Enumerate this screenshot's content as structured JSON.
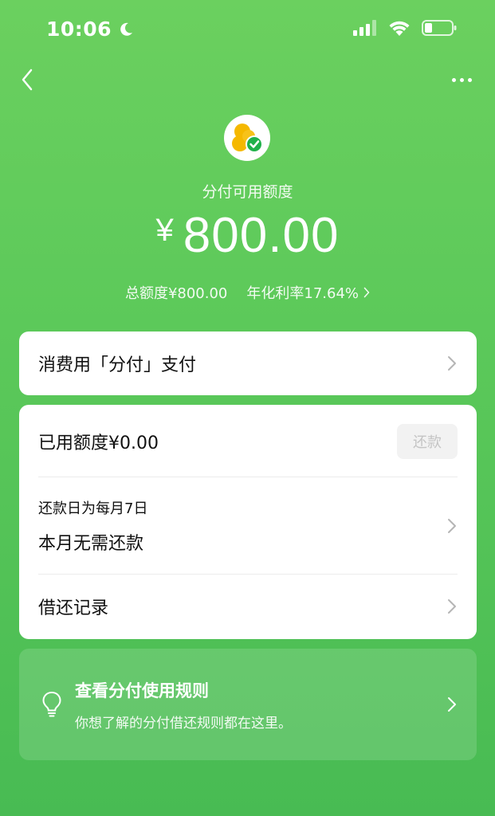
{
  "status_bar": {
    "time": "10:06",
    "icons": [
      "moon-icon",
      "signal-icon",
      "wifi-icon",
      "battery-icon"
    ]
  },
  "nav": {
    "back_icon": "back-chevron-icon",
    "more_icon": "more-dots-icon"
  },
  "header": {
    "logo_icon": "fenfu-logo-icon",
    "title": "分付可用额度",
    "currency": "¥",
    "amount": "800.00",
    "total_limit": "总额度¥800.00",
    "annual_rate": "年化利率17.64%"
  },
  "pay_card": {
    "label": "消费用「分付」支付"
  },
  "detail_card": {
    "used_label": "已用额度¥0.00",
    "repay_button": "还款",
    "due_date": "还款日为每月7日",
    "due_status": "本月无需还款",
    "history_label": "借还记录"
  },
  "rules_card": {
    "icon": "lightbulb-icon",
    "title": "查看分付使用规则",
    "subtitle": "你想了解的分付借还规则都在这里。"
  },
  "colors": {
    "brand_green": "#5cc95a",
    "logo_yellow": "#f5b800",
    "logo_green": "#20b14a"
  }
}
